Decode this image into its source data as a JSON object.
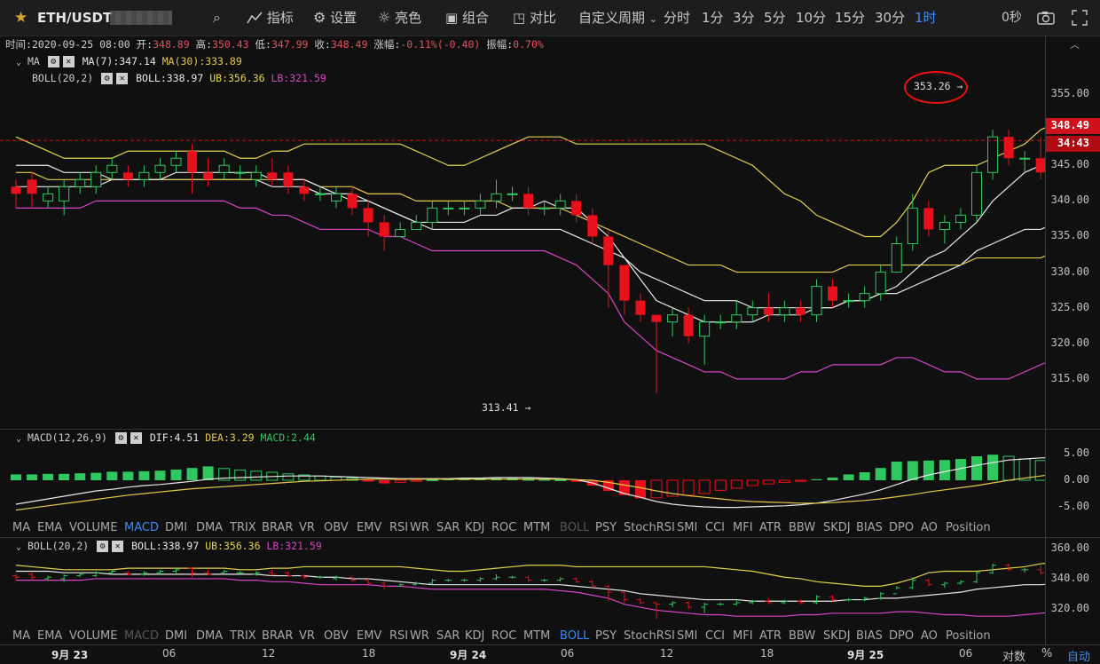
{
  "topbar": {
    "symbol": "ETH/USDT",
    "items": [
      "指标",
      "设置",
      "亮色",
      "组合",
      "对比"
    ],
    "period_menu": "自定义周期",
    "periods": [
      "分时",
      "1分",
      "3分",
      "5分",
      "10分",
      "15分",
      "30分",
      "1时"
    ],
    "selected_period": "1时",
    "countdown": "0秒"
  },
  "ohlc": {
    "time_label": "时间:",
    "time": "2020-09-25 08:00",
    "open_label": "开:",
    "open": "348.89",
    "high_label": "高:",
    "high": "350.43",
    "low_label": "低:",
    "low": "347.99",
    "close_label": "收:",
    "close": "348.49",
    "change_label": "涨幅:",
    "change": "-0.11%(-0.40)",
    "amp_label": "振幅:",
    "amp": "0.70%"
  },
  "main_legend": {
    "ma_name": "MA",
    "ma7": "MA(7):347.14",
    "ma30": "MA(30):333.89",
    "boll_name": "BOLL(20,2)",
    "boll": "BOLL:338.97",
    "ub": "UB:356.36",
    "lb": "LB:321.59"
  },
  "macd_legend": {
    "name": "MACD(12,26,9)",
    "dif": "DIF:4.51",
    "dea": "DEA:3.29",
    "macd": "MACD:2.44"
  },
  "boll_legend": {
    "name": "BOLL(20,2)",
    "boll": "BOLL:338.97",
    "ub": "UB:356.36",
    "lb": "LB:321.59"
  },
  "indicator_tabs": [
    "MA",
    "EMA",
    "VOLUME",
    "MACD",
    "DMI",
    "DMA",
    "TRIX",
    "BRAR",
    "VR",
    "OBV",
    "EMV",
    "RSI",
    "WR",
    "SAR",
    "KDJ",
    "ROC",
    "MTM",
    "BOLL",
    "PSY",
    "StochRSI",
    "SMI",
    "CCI",
    "MFI",
    "ATR",
    "BBW",
    "SKDJ",
    "BIAS",
    "DPO",
    "AO",
    "Position"
  ],
  "tabs_row1": {
    "active": "MACD",
    "disabled": "BOLL"
  },
  "tabs_row2": {
    "active": "BOLL",
    "disabled": "MACD"
  },
  "price_axis": [
    "355.00",
    "350.00",
    "345.00",
    "340.00",
    "335.00",
    "330.00",
    "325.00",
    "320.00",
    "315.00"
  ],
  "current_price": "348.49",
  "countdown_tag": "34:43",
  "macd_axis": [
    "5.00",
    "0.00",
    "-5.00"
  ],
  "boll_axis": [
    "360.00",
    "340.00",
    "320.00"
  ],
  "time_axis": [
    {
      "label": "9月 23",
      "bold": true
    },
    {
      "label": "06",
      "bold": false
    },
    {
      "label": "12",
      "bold": false
    },
    {
      "label": "18",
      "bold": false
    },
    {
      "label": "9月 24",
      "bold": true
    },
    {
      "label": "06",
      "bold": false
    },
    {
      "label": "12",
      "bold": false
    },
    {
      "label": "18",
      "bold": false
    },
    {
      "label": "9月 25",
      "bold": true
    },
    {
      "label": "06",
      "bold": false
    }
  ],
  "footer": {
    "log": "对数",
    "pct": "%",
    "auto": "自动"
  },
  "annotations": {
    "high": "353.26 →",
    "low": "313.41 →"
  },
  "colors": {
    "up": "#2ec85f",
    "down": "#e8101a",
    "ma7": "#e8e8e8",
    "ma30": "#e5c94a",
    "ub": "#e5d24a",
    "lb": "#d844c8",
    "accent": "#3d8bff"
  },
  "chart_data": {
    "type": "candlestick",
    "candles": [
      [
        342,
        341,
        343,
        339
      ],
      [
        343,
        341,
        344,
        339
      ],
      [
        340,
        341,
        342,
        339
      ],
      [
        340,
        342,
        343,
        338
      ],
      [
        342,
        343,
        344,
        341
      ],
      [
        342,
        344,
        345,
        341
      ],
      [
        344,
        345,
        346,
        343
      ],
      [
        344,
        343,
        345,
        342
      ],
      [
        343,
        344,
        345,
        342
      ],
      [
        344,
        345,
        346,
        343
      ],
      [
        345,
        346,
        347,
        344
      ],
      [
        347,
        344,
        348,
        341
      ],
      [
        344,
        343,
        346,
        342
      ],
      [
        344,
        345,
        346,
        343
      ],
      [
        344,
        344,
        345,
        343
      ],
      [
        343,
        344,
        345,
        342
      ],
      [
        344,
        343,
        346,
        342
      ],
      [
        344,
        342,
        345,
        341
      ],
      [
        342,
        341,
        343,
        340
      ],
      [
        341,
        341,
        342,
        340
      ],
      [
        340,
        341,
        342,
        339
      ],
      [
        341,
        339,
        342,
        338
      ],
      [
        339,
        337,
        340,
        335
      ],
      [
        337,
        335,
        338,
        333
      ],
      [
        335,
        336,
        337,
        335
      ],
      [
        336,
        337,
        338,
        336
      ],
      [
        337,
        339,
        340,
        336
      ],
      [
        339,
        339,
        340,
        338
      ],
      [
        339,
        339,
        340,
        338
      ],
      [
        339,
        340,
        341,
        338
      ],
      [
        340,
        341,
        343,
        339
      ],
      [
        341,
        341,
        342,
        340
      ],
      [
        341,
        339,
        342,
        338
      ],
      [
        339,
        339,
        340,
        338
      ],
      [
        339,
        340,
        341,
        338
      ],
      [
        340,
        338,
        341,
        337
      ],
      [
        338,
        335,
        339,
        334
      ],
      [
        335,
        331,
        336,
        325
      ],
      [
        331,
        326,
        331,
        324
      ],
      [
        326,
        324,
        327,
        323
      ],
      [
        324,
        323,
        324,
        313
      ],
      [
        323,
        324,
        325,
        321
      ],
      [
        324,
        321,
        325,
        320
      ],
      [
        321,
        323,
        324,
        317
      ],
      [
        323,
        323,
        324,
        322
      ],
      [
        323,
        324,
        326,
        322
      ],
      [
        324,
        325,
        326,
        323
      ],
      [
        325,
        324,
        327,
        323
      ],
      [
        324,
        325,
        326,
        323
      ],
      [
        325,
        324,
        326,
        323
      ],
      [
        324,
        328,
        329,
        323
      ],
      [
        328,
        326,
        329,
        325
      ],
      [
        326,
        326,
        327,
        325
      ],
      [
        326,
        327,
        328,
        325
      ],
      [
        327,
        330,
        331,
        326
      ],
      [
        330,
        334,
        335,
        333
      ],
      [
        334,
        339,
        341,
        333
      ],
      [
        339,
        336,
        340,
        335
      ],
      [
        336,
        337,
        338,
        334
      ],
      [
        337,
        338,
        339,
        336
      ],
      [
        338,
        344,
        345,
        337
      ],
      [
        344,
        349,
        350,
        343
      ],
      [
        349,
        346,
        350,
        345
      ],
      [
        346,
        346,
        347,
        344
      ],
      [
        346,
        344,
        349,
        343
      ],
      [
        344,
        346,
        347,
        343
      ],
      [
        346,
        346,
        348,
        345
      ],
      [
        346,
        346,
        347,
        345
      ],
      [
        346,
        351,
        353,
        345
      ],
      [
        351,
        349,
        351,
        348
      ],
      [
        349,
        348,
        350,
        348
      ]
    ],
    "ma7": [
      342,
      342,
      342,
      342,
      342,
      342,
      343,
      343,
      343,
      343,
      344,
      344,
      344,
      344,
      344,
      344,
      343,
      343,
      343,
      342,
      341,
      341,
      340,
      339,
      338,
      337,
      337,
      337,
      337,
      338,
      338,
      339,
      339,
      340,
      339,
      339,
      337,
      335,
      332,
      329,
      326,
      325,
      324,
      323,
      323,
      323,
      323,
      324,
      324,
      324,
      325,
      325,
      326,
      326,
      327,
      328,
      330,
      332,
      333,
      335,
      337,
      340,
      342,
      344,
      345,
      345,
      346,
      346,
      346,
      347,
      347
    ],
    "ma30": [
      344,
      344,
      343,
      343,
      343,
      343,
      343,
      343,
      343,
      343,
      343,
      343,
      343,
      343,
      343,
      343,
      343,
      343,
      343,
      342,
      342,
      342,
      341,
      341,
      341,
      340,
      340,
      340,
      340,
      340,
      340,
      339,
      339,
      339,
      339,
      338,
      337,
      336,
      335,
      334,
      333,
      332,
      331,
      331,
      331,
      330,
      330,
      330,
      330,
      330,
      330,
      330,
      331,
      331,
      331,
      331,
      331,
      331,
      331,
      331,
      332,
      332,
      332,
      332,
      332,
      333,
      333,
      333,
      333,
      334,
      334
    ],
    "boll_mid": [
      345,
      345,
      345,
      344,
      344,
      344,
      343,
      343,
      343,
      343,
      343,
      343,
      343,
      343,
      343,
      343,
      342,
      342,
      342,
      341,
      341,
      340,
      340,
      339,
      338,
      337,
      336,
      336,
      336,
      336,
      336,
      336,
      336,
      336,
      336,
      335,
      334,
      333,
      332,
      330,
      329,
      328,
      327,
      326,
      326,
      326,
      325,
      325,
      325,
      325,
      325,
      325,
      326,
      326,
      327,
      327,
      328,
      329,
      330,
      331,
      333,
      334,
      335,
      336,
      336,
      337,
      337,
      338,
      338,
      339,
      339
    ],
    "boll_ub": [
      349,
      348,
      347,
      346,
      346,
      346,
      346,
      347,
      347,
      347,
      347,
      347,
      347,
      347,
      346,
      346,
      347,
      347,
      348,
      348,
      348,
      348,
      348,
      348,
      348,
      347,
      346,
      345,
      345,
      346,
      347,
      348,
      349,
      349,
      349,
      348,
      348,
      348,
      348,
      348,
      348,
      348,
      348,
      348,
      347,
      346,
      345,
      343,
      341,
      340,
      338,
      337,
      336,
      335,
      335,
      337,
      340,
      344,
      345,
      345,
      345,
      346,
      347,
      348,
      350,
      351,
      352,
      353,
      354,
      355,
      356
    ],
    "boll_lb": [
      339,
      339,
      339,
      339,
      339,
      340,
      340,
      340,
      340,
      340,
      340,
      340,
      340,
      340,
      339,
      339,
      338,
      338,
      337,
      336,
      336,
      336,
      336,
      335,
      335,
      334,
      333,
      333,
      333,
      333,
      333,
      333,
      333,
      333,
      332,
      331,
      329,
      327,
      323,
      321,
      319,
      318,
      317,
      316,
      316,
      315,
      315,
      315,
      315,
      316,
      316,
      317,
      317,
      317,
      317,
      318,
      318,
      317,
      316,
      316,
      315,
      315,
      315,
      316,
      317,
      318,
      319,
      320,
      321,
      322,
      322
    ],
    "macd_hist": [
      1.1,
      1.1,
      1.2,
      1.2,
      1.3,
      1.4,
      1.6,
      1.6,
      1.7,
      1.8,
      2.0,
      2.3,
      2.6,
      2.2,
      1.9,
      1.7,
      1.5,
      1.2,
      1.0,
      0.8,
      0.6,
      0.4,
      -0.1,
      -0.6,
      -0.4,
      -0.2,
      0.1,
      0.2,
      0.3,
      0.4,
      0.4,
      0.4,
      0.3,
      0.2,
      0.1,
      -0.3,
      -1.0,
      -2.0,
      -2.8,
      -3.4,
      -3.3,
      -3.0,
      -2.8,
      -2.5,
      -1.9,
      -1.5,
      -1.0,
      -0.7,
      -0.4,
      -0.2,
      0.2,
      0.5,
      1.1,
      1.5,
      2.3,
      3.5,
      3.6,
      3.7,
      3.8,
      4.0,
      4.5,
      4.8,
      4.5,
      4.0,
      3.7,
      3.3,
      3.2,
      3.0,
      3.3,
      3.0,
      2.4
    ],
    "macd_dif": [
      -4.5,
      -4.0,
      -3.5,
      -3.0,
      -2.5,
      -2.0,
      -1.7,
      -1.3,
      -1.0,
      -0.8,
      -0.5,
      -0.2,
      0.2,
      0.4,
      0.5,
      0.6,
      0.7,
      0.8,
      0.8,
      0.8,
      0.7,
      0.6,
      0.5,
      0.4,
      0.3,
      0.3,
      0.3,
      0.3,
      0.4,
      0.4,
      0.5,
      0.5,
      0.5,
      0.4,
      0.3,
      0.1,
      -0.5,
      -1.5,
      -2.5,
      -3.2,
      -4.0,
      -4.5,
      -4.8,
      -5.0,
      -5.1,
      -5.1,
      -5.0,
      -4.9,
      -4.8,
      -4.6,
      -4.3,
      -3.8,
      -3.2,
      -2.6,
      -1.8,
      -0.8,
      0.2,
      1.0,
      1.6,
      2.2,
      2.8,
      3.3,
      3.8,
      4.0,
      4.2,
      4.3,
      4.3,
      4.3,
      4.4,
      4.5,
      4.5
    ],
    "macd_dea": [
      -5.6,
      -5.2,
      -4.8,
      -4.4,
      -4.0,
      -3.6,
      -3.2,
      -2.8,
      -2.5,
      -2.2,
      -1.9,
      -1.6,
      -1.4,
      -1.2,
      -1.0,
      -0.8,
      -0.6,
      -0.4,
      -0.2,
      -0.1,
      0.0,
      0.1,
      0.2,
      0.2,
      0.2,
      0.2,
      0.2,
      0.2,
      0.2,
      0.2,
      0.2,
      0.2,
      0.2,
      0.2,
      0.2,
      0.1,
      0.0,
      -0.4,
      -0.9,
      -1.4,
      -2.0,
      -2.5,
      -2.9,
      -3.2,
      -3.5,
      -3.8,
      -4.0,
      -4.1,
      -4.2,
      -4.3,
      -4.3,
      -4.2,
      -4.0,
      -3.8,
      -3.5,
      -3.1,
      -2.7,
      -2.2,
      -1.8,
      -1.4,
      -1.0,
      -0.5,
      0.0,
      0.4,
      0.8,
      1.2,
      1.6,
      2.0,
      2.3,
      2.7,
      3.3
    ],
    "price_range": [
      310,
      358
    ],
    "macd_range": [
      -6,
      6
    ],
    "boll_range": [
      308,
      366
    ]
  }
}
